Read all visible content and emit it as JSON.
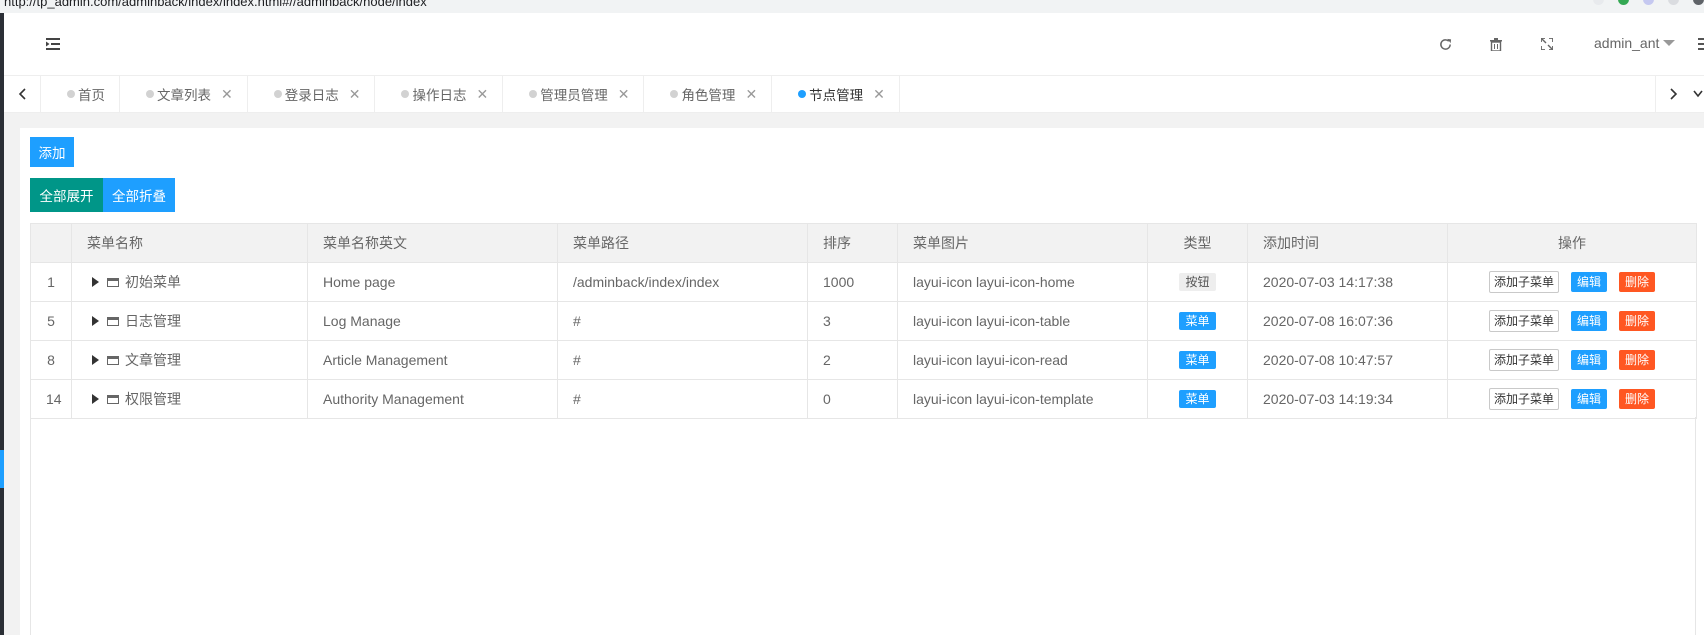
{
  "browser": {
    "url": "http://tp_admin.com/adminback/index/index.html#//adminback/node/index"
  },
  "header": {
    "username": "admin_ant"
  },
  "tabs": [
    {
      "label": "首页",
      "closable": false,
      "active": false
    },
    {
      "label": "文章列表",
      "closable": true,
      "active": false
    },
    {
      "label": "登录日志",
      "closable": true,
      "active": false
    },
    {
      "label": "操作日志",
      "closable": true,
      "active": false
    },
    {
      "label": "管理员管理",
      "closable": true,
      "active": false
    },
    {
      "label": "角色管理",
      "closable": true,
      "active": false
    },
    {
      "label": "节点管理",
      "closable": true,
      "active": true
    }
  ],
  "toolbar": {
    "add_label": "添加",
    "expand_all_label": "全部展开",
    "collapse_all_label": "全部折叠"
  },
  "colors": {
    "primary": "#1e9fff",
    "green": "#009688",
    "danger": "#ff5722"
  },
  "table": {
    "columns": [
      "",
      "菜单名称",
      "菜单名称英文",
      "菜单路径",
      "排序",
      "菜单图片",
      "类型",
      "添加时间",
      "操作"
    ],
    "rows": [
      {
        "id": "1",
        "name": "初始菜单",
        "name_en": "Home page",
        "path": "/adminback/index/index",
        "sort": "1000",
        "icon": "layui-icon layui-icon-home",
        "type": "按钮",
        "type_kind": "button",
        "created": "2020-07-03 14:17:38"
      },
      {
        "id": "5",
        "name": "日志管理",
        "name_en": "Log Manage",
        "path": "#",
        "sort": "3",
        "icon": "layui-icon layui-icon-table",
        "type": "菜单",
        "type_kind": "menu",
        "created": "2020-07-08 16:07:36"
      },
      {
        "id": "8",
        "name": "文章管理",
        "name_en": "Article Management",
        "path": "#",
        "sort": "2",
        "icon": "layui-icon layui-icon-read",
        "type": "菜单",
        "type_kind": "menu",
        "created": "2020-07-08 10:47:57"
      },
      {
        "id": "14",
        "name": "权限管理",
        "name_en": "Authority Management",
        "path": "#",
        "sort": "0",
        "icon": "layui-icon layui-icon-template",
        "type": "菜单",
        "type_kind": "menu",
        "created": "2020-07-03 14:19:34"
      }
    ],
    "actions": {
      "add_child": "添加子菜单",
      "edit": "编辑",
      "delete": "删除"
    }
  }
}
